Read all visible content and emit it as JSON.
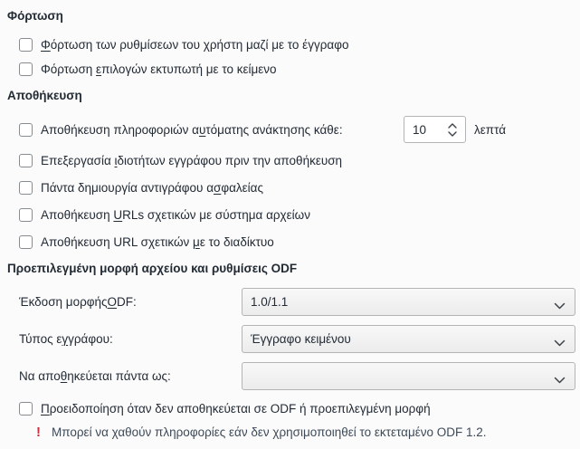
{
  "colors": {
    "warning_red": "#cc2f44",
    "text": "#232b35",
    "note_text": "#3e4a58"
  },
  "load": {
    "title": "Φόρτωση",
    "items": [
      {
        "pre": "",
        "mn": "Φ",
        "post": "όρτωση των ρυθμίσεων του χρήστη μαζί με το έγγραφο",
        "checked": false
      },
      {
        "pre": "Φόρτωση ",
        "mn": "ε",
        "post": "πιλογών εκτυπωτή με το κείμενο",
        "checked": false
      }
    ]
  },
  "save": {
    "title": "Αποθήκευση",
    "autorecovery": {
      "pre": "Αποθήκευση πληροφοριών α",
      "mn": "υ",
      "post": "τόματης ανάκτησης κάθε:",
      "checked": false,
      "value": "10",
      "unit": "λεπτά"
    },
    "items": [
      {
        "pre": "Επεξεργασία ",
        "mn": "ι",
        "post": "διοτήτων εγγράφου πριν την αποθήκευση",
        "checked": false
      },
      {
        "pre": "Πάντα δημιουργία αντιγράφου α",
        "mn": "σ",
        "post": "φαλείας",
        "checked": false
      },
      {
        "pre": "Αποθήκευση ",
        "mn": "U",
        "post": "RLs σχετικών με σύστημα αρχείων",
        "checked": false
      },
      {
        "pre": "Αποθήκευση URL σχετικών ",
        "mn": "μ",
        "post": "ε το διαδίκτυο",
        "checked": false
      }
    ]
  },
  "odf": {
    "title": "Προεπιλεγμένη μορφή αρχείου και ρυθμίσεις ODF",
    "rows": [
      {
        "label": {
          "pre": "Έκδοση μορφής ",
          "mn": "O",
          "post": "DF:"
        },
        "value": "1.0/1.1"
      },
      {
        "label": {
          "pre": "Τύπος ε",
          "mn": "γ",
          "post": "γράφου:"
        },
        "value": "Έγγραφο κειμένου"
      },
      {
        "label": {
          "pre": "Να απο",
          "mn": "θ",
          "post": "ηκεύεται πάντα ως:"
        },
        "value": ""
      }
    ],
    "warning_checkbox": {
      "pre": "",
      "mn": "Π",
      "post": "ροειδοποίηση όταν δεν αποθηκεύεται σε ODF ή προεπιλεγμένη μορφή",
      "checked": false
    },
    "note": {
      "icon": "!",
      "text": "Μπορεί να χαθούν πληροφορίες εάν δεν χρησιμοποιηθεί το εκτεταμένο ODF 1.2."
    }
  }
}
